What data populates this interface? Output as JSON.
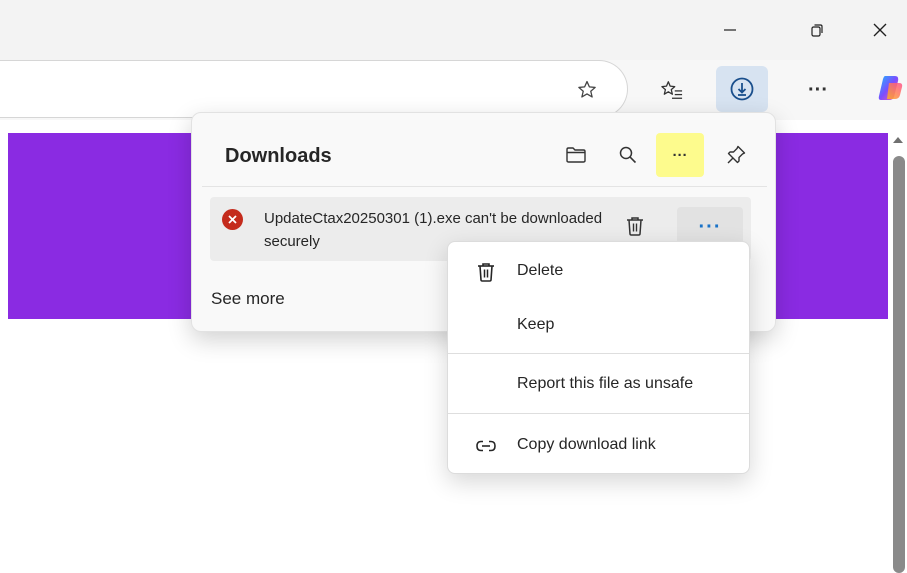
{
  "window": {
    "minimize_icon": "minimize-icon",
    "restore_icon": "restore-icon",
    "close_icon": "close-icon"
  },
  "toolbar": {
    "favorite_icon": "star-icon",
    "favorites_icon": "favorites-list-icon",
    "downloads_icon": "download-icon",
    "more_label": "···",
    "copilot_icon": "copilot-icon"
  },
  "downloads": {
    "title": "Downloads",
    "item": {
      "status": "error",
      "text": "UpdateCtax20250301 (1).exe can't be downloaded securely",
      "more_label": "···"
    },
    "see_more": "See more",
    "header_more_label": "···"
  },
  "context_menu": {
    "items": [
      {
        "label": "Delete",
        "icon": "trash-icon"
      },
      {
        "label": "Keep",
        "icon": ""
      },
      {
        "label": "Report this file as unsafe",
        "icon": ""
      },
      {
        "label": "Copy download link",
        "icon": "link-icon"
      }
    ]
  },
  "colors": {
    "accent": "#1a73c8",
    "page_band": "#8a2be2",
    "error": "#c42b1c",
    "highlight": "#fdfb8d"
  }
}
